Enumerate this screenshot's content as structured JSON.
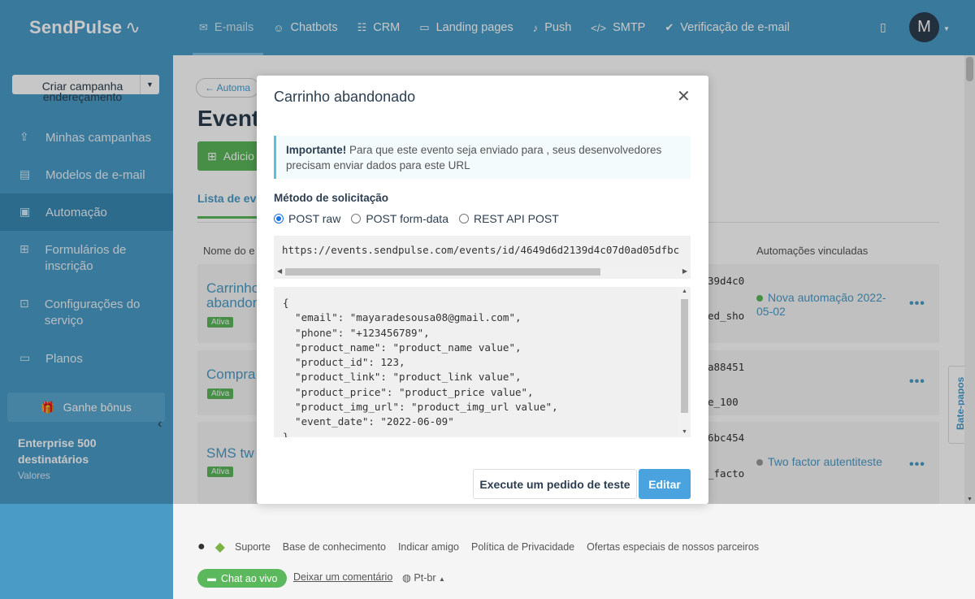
{
  "brand": {
    "logo": "SendPulse",
    "logo_mark": "✓",
    "accent": "#4a9cc7"
  },
  "sidebar": {
    "create_button": "Criar campanha endereçamento",
    "items": [
      {
        "label": "Minhas campanhas",
        "icon": "upload-icon"
      },
      {
        "label": "Modelos de e-mail",
        "icon": "template-icon"
      },
      {
        "label": "Automação",
        "icon": "automation-icon",
        "active": true
      },
      {
        "label": "Formulários de inscrição",
        "icon": "form-icon"
      },
      {
        "label": "Configurações do serviço",
        "icon": "settings-icon"
      },
      {
        "label": "Planos",
        "icon": "plans-icon"
      }
    ],
    "bonus": "Ganhe bônus",
    "plan_name": "Enterprise 500 destinatários",
    "plan_sub": "Valores"
  },
  "topnav": {
    "tabs": [
      {
        "label": "E-mails",
        "icon": "mail-icon",
        "active": true
      },
      {
        "label": "Chatbots",
        "icon": "chatbot-icon"
      },
      {
        "label": "CRM",
        "icon": "crm-icon"
      },
      {
        "label": "Landing pages",
        "icon": "landing-icon"
      },
      {
        "label": "Push",
        "icon": "bell-icon"
      },
      {
        "label": "SMTP",
        "icon": "code-icon"
      },
      {
        "label": "Verificação de e-mail",
        "icon": "check-circle-icon"
      }
    ],
    "avatar": "M"
  },
  "page": {
    "breadcrumb": "← Automa",
    "title": "Event",
    "add_button": "Adicio",
    "subtab": "Lista de ev",
    "col_name": "Nome do e",
    "col_linked": "Automações vinculadas",
    "rows": [
      {
        "name": "Carrinho abandon",
        "badge": "Ativa",
        "mid1": "39d4c0",
        "mid2": "ed_sho",
        "auto": "Nova automação 2022-05-02",
        "auto_color": "#5cb85c"
      },
      {
        "name": "Compra",
        "badge": "Ativa",
        "mid1": "a88451",
        "mid2": "e_100",
        "auto": "",
        "auto_color": ""
      },
      {
        "name": "SMS tw",
        "badge": "Ativa",
        "mid1": "6bc454",
        "mid2": "_facto",
        "auto": "Two factor autentiteste",
        "auto_color": "#999999"
      }
    ],
    "chat_side": "Bate-papos"
  },
  "modal": {
    "title": "Carrinho abandonado",
    "notice_bold": "Importante!",
    "notice_text": " Para que este evento seja enviado para , seus desenvolvedores precisam enviar dados para este URL",
    "method_label": "Método de solicitação",
    "methods": [
      {
        "label": "POST raw",
        "selected": true
      },
      {
        "label": "POST form-data",
        "selected": false
      },
      {
        "label": "REST API POST",
        "selected": false
      }
    ],
    "url": "https://events.sendpulse.com/events/id/4649d6d2139d4c07d0ad05dfbc",
    "json": "{\n  \"email\": \"mayaradesousa08@gmail.com\",\n  \"phone\": \"+123456789\",\n  \"product_name\": \"product_name value\",\n  \"product_id\": 123,\n  \"product_link\": \"product_link value\",\n  \"product_price\": \"product_price value\",\n  \"product_img_url\": \"product_img_url value\",\n  \"event_date\": \"2022-06-09\"\n}",
    "test_button": "Execute um pedido de teste",
    "edit_button": "Editar"
  },
  "footer": {
    "links": [
      "Suporte",
      "Base de conhecimento",
      "Indicar amigo",
      "Política de Privacidade",
      "Ofertas especiais de nossos parceiros"
    ],
    "chat_live": "Chat ao vivo",
    "comment": "Deixar um comentário",
    "lang": "Pt-br"
  }
}
